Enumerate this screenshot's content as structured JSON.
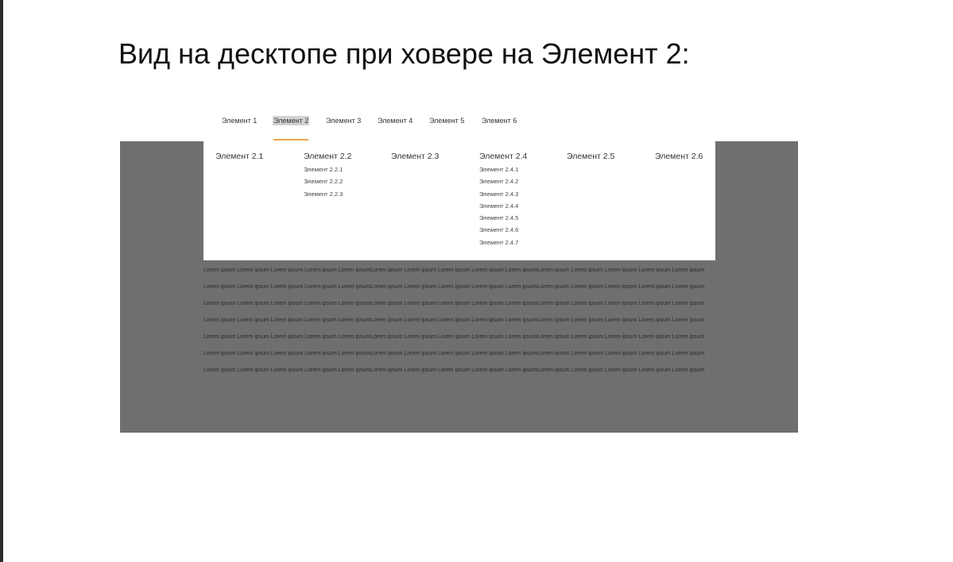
{
  "heading": "Вид на десктопе при ховере на Элемент 2:",
  "nav": {
    "items": [
      "Элемент 1",
      "Элемент 2",
      "Элемент 3",
      "Элемент 4",
      "Элемент 5",
      "Элемент 6"
    ],
    "hovered_index": 1,
    "accent_color": "#f0a24a"
  },
  "dropdown": {
    "columns": [
      {
        "title": "Элемент 2.1",
        "items": []
      },
      {
        "title": "Элемент 2.2",
        "items": [
          "Элемент 2.2.1",
          "Элемент 2.2.2",
          "Элемент 2.2.3"
        ]
      },
      {
        "title": "Элемент 2.3",
        "items": []
      },
      {
        "title": "Элемент 2.4",
        "items": [
          "Элемент 2.4.1",
          "Элемент 2.4.2",
          "Элемент 2.4.3",
          "Элемент 2.4.4",
          "Элемент 2.4.5",
          "Элемент 2.4.6",
          "Элемент 2.4.7"
        ]
      },
      {
        "title": "Элемент 2.5",
        "items": []
      },
      {
        "title": "Элемент 2.6",
        "items": []
      }
    ]
  },
  "content": {
    "overlay_color": "#6f6f6f",
    "paragraphs": [
      "Lorem ipsum Lorem ipsum Lorem ipsum Lorem ipsum Lorem ipsumLorem ipsum Lorem ipsum Lorem ipsum Lorem ipsum Lorem ipsumLorem ipsum Lorem ipsum Lorem ipsum Lorem ipsum Lorem ipsum",
      "Lorem ipsum Lorem ipsum Lorem ipsum Lorem ipsum Lorem ipsumLorem ipsum Lorem ipsum Lorem ipsum Lorem ipsum Lorem ipsumLorem ipsum Lorem ipsum Lorem ipsum Lorem ipsum Lorem ipsum",
      "Lorem ipsum Lorem ipsum Lorem ipsum Lorem ipsum Lorem ipsumLorem ipsum Lorem ipsum Lorem ipsum Lorem ipsum Lorem ipsumLorem ipsum Lorem ipsum Lorem ipsum Lorem ipsum Lorem ipsum",
      "Lorem ipsum Lorem ipsum Lorem ipsum Lorem ipsum Lorem ipsumLorem ipsum Lorem ipsum Lorem ipsum Lorem ipsum Lorem ipsumLorem ipsum Lorem ipsum Lorem ipsum Lorem ipsum Lorem ipsum",
      "Lorem ipsum Lorem ipsum Lorem ipsum Lorem ipsum Lorem ipsumLorem ipsum Lorem ipsum Lorem ipsum Lorem ipsum Lorem ipsumLorem ipsum Lorem ipsum Lorem ipsum Lorem ipsum Lorem ipsum",
      "Lorem ipsum Lorem ipsum Lorem ipsum Lorem ipsum Lorem ipsumLorem ipsum Lorem ipsum Lorem ipsum Lorem ipsum Lorem ipsumLorem ipsum Lorem ipsum Lorem ipsum Lorem ipsum Lorem ipsum",
      "Lorem ipsum Lorem ipsum Lorem ipsum Lorem ipsum Lorem ipsumLorem ipsum Lorem ipsum Lorem ipsum Lorem ipsum Lorem ipsumLorem ipsum Lorem ipsum Lorem ipsum Lorem ipsum Lorem ipsum"
    ]
  }
}
